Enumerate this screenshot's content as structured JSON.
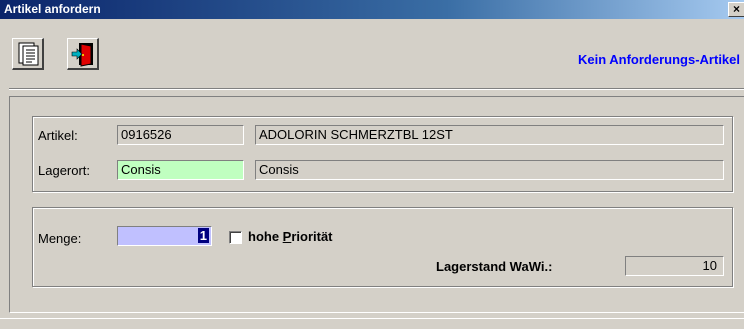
{
  "window": {
    "title": "Artikel anfordern",
    "close_glyph": "×"
  },
  "toolbar": {
    "buttons": [
      {
        "icon": "document-icon"
      },
      {
        "icon": "exit-door-icon"
      }
    ],
    "status_message": "Kein Anforderungs-Artikel"
  },
  "article_group": {
    "artikel_label": "Artikel:",
    "artikel_number": "0916526",
    "artikel_name": "ADOLORIN SCHMERZTBL 12ST",
    "lagerort_label": "Lagerort:",
    "lagerort_value": "Consis",
    "lagerort_name": "Consis"
  },
  "quantity_group": {
    "menge_label": "Menge:",
    "menge_value": "1",
    "priority_label_before": "hohe ",
    "priority_label_underlined": "P",
    "priority_label_after": "riorität",
    "priority_checked": false,
    "lagerstand_label": "Lagerstand WaWi.:",
    "lagerstand_value": "10"
  },
  "colors": {
    "accent_text": "#0000ff",
    "lagerort_bg": "#c0ffc0",
    "menge_bg": "#c0c0ff"
  }
}
